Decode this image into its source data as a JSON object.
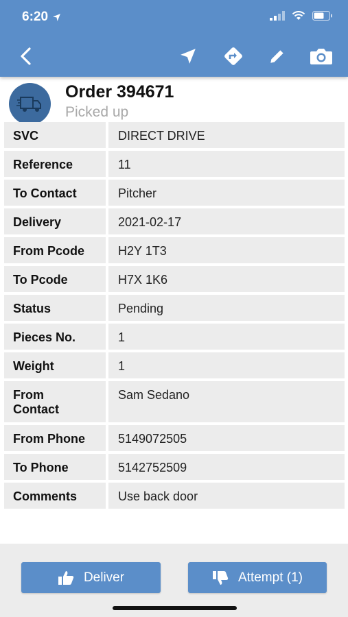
{
  "status_bar": {
    "time": "6:20"
  },
  "nav": {
    "back_icon": "chevron-left-icon",
    "actions": [
      "navigate-arrow-icon",
      "directions-icon",
      "edit-pencil-icon",
      "camera-icon"
    ]
  },
  "order": {
    "title": "Order 394671",
    "status": "Picked up",
    "avatar_icon": "delivery-truck-icon"
  },
  "details": [
    {
      "label": "SVC",
      "value": "DIRECT DRIVE"
    },
    {
      "label": "Reference",
      "value": "11"
    },
    {
      "label": "To Contact",
      "value": "Pitcher"
    },
    {
      "label": "Delivery",
      "value": "2021-02-17"
    },
    {
      "label": "From Pcode",
      "value": "H2Y 1T3"
    },
    {
      "label": "To Pcode",
      "value": "H7X 1K6"
    },
    {
      "label": "Status",
      "value": "Pending"
    },
    {
      "label": "Pieces No.",
      "value": "1"
    },
    {
      "label": "Weight",
      "value": "1"
    },
    {
      "label": "From Contact",
      "value": "Sam Sedano"
    },
    {
      "label": "From Phone",
      "value": "5149072505"
    },
    {
      "label": "To Phone",
      "value": "5142752509"
    },
    {
      "label": "Comments",
      "value": "Use back door"
    }
  ],
  "actions": {
    "deliver_label": "Deliver",
    "attempt_label": "Attempt (1)"
  },
  "colors": {
    "primary": "#5b8ec9",
    "avatar": "#3c6a9e",
    "cell_bg": "#ececec"
  }
}
